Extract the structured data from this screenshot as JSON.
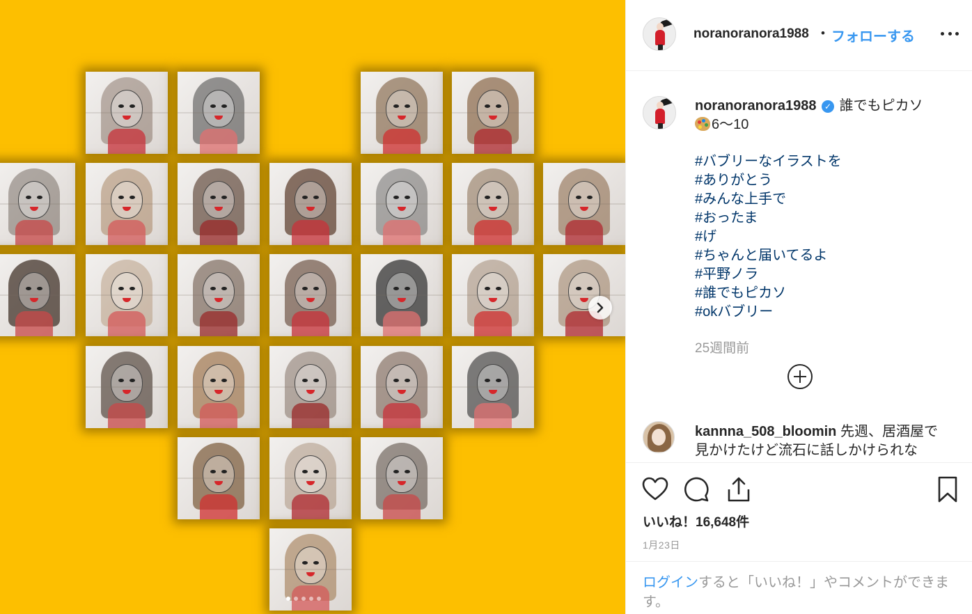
{
  "post": {
    "username": "noranoranora1988",
    "separator": "•",
    "follow_label": "フォローする",
    "caption": {
      "title": "誰でもピカソ",
      "range": "6〜10",
      "hashtags": [
        "#バブリーなイラストを",
        "#ありがとう",
        "#みんな上手で",
        "#おったま",
        "#げ",
        "#ちゃんと届いてるよ",
        "#平野ノラ",
        "#誰でもピカソ",
        "#okバブリー"
      ]
    },
    "time_ago": "25週間前",
    "comment": {
      "username": "kannna_508_bloomin",
      "text": "先週、居酒屋で見かけたけど流石に話しかけられな"
    },
    "likes_label": "いいね！",
    "likes_count": "16,648件",
    "date": "1月23日",
    "login_prompt": {
      "link": "ログイン",
      "rest": "すると「いいね！」やコメントができます。"
    }
  },
  "media": {
    "background_color": "#fdbf00",
    "carousel_pages": 5,
    "current_page": 1
  }
}
